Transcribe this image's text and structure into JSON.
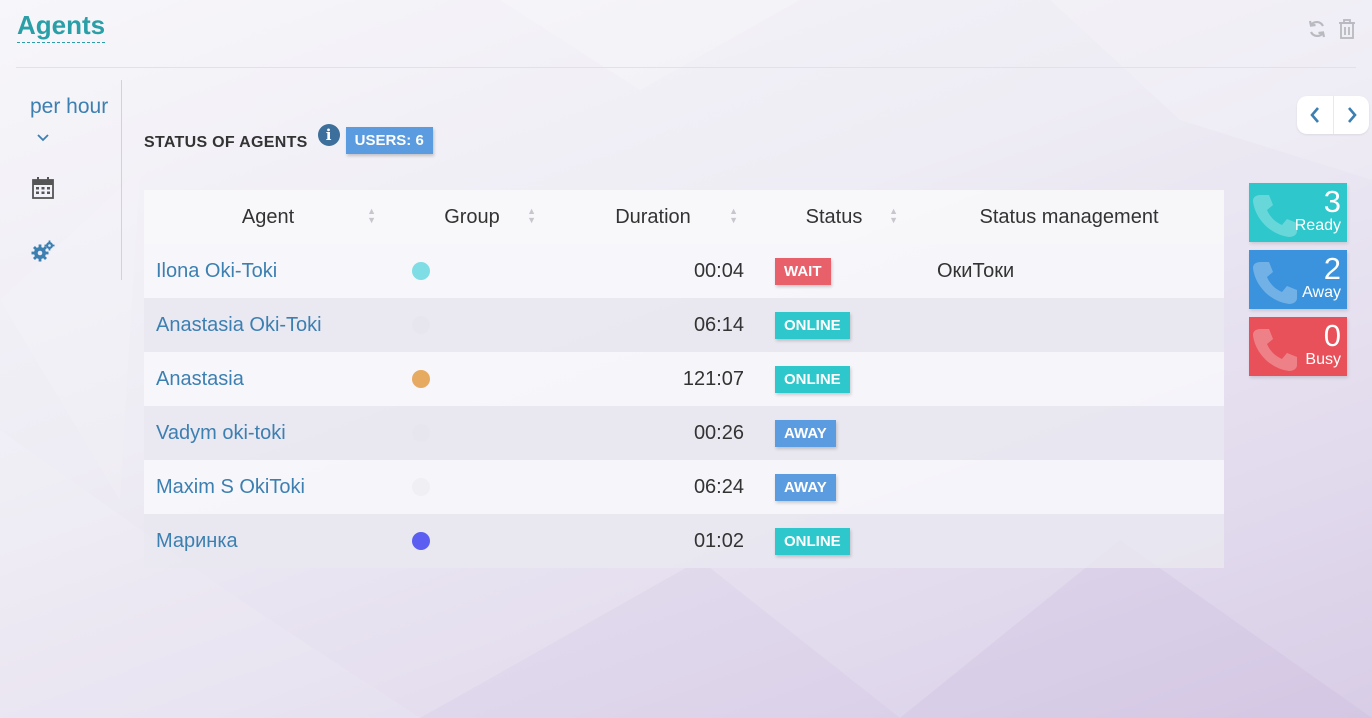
{
  "page": {
    "title": "Agents"
  },
  "sidebar": {
    "period": "per hour"
  },
  "section": {
    "title": "STATUS OF AGENTS",
    "users_badge": "USERS: 6"
  },
  "table": {
    "headers": [
      "Agent",
      "Group",
      "Duration",
      "Status",
      "Status management"
    ],
    "rows": [
      {
        "agent": "Ilona Oki-Toki",
        "group_color": "#7fdde5",
        "duration": "00:04",
        "status": "WAIT",
        "status_color": "#e8606a",
        "management": "ОкиТоки"
      },
      {
        "agent": "Anastasia Oki-Toki",
        "group_color": "#e7e6ee",
        "duration": "06:14",
        "status": "ONLINE",
        "status_color": "#2ec8cc",
        "management": ""
      },
      {
        "agent": "Anastasia",
        "group_color": "#e6aa60",
        "duration": "121:07",
        "status": "ONLINE",
        "status_color": "#2ec8cc",
        "management": ""
      },
      {
        "agent": "Vadym oki-toki",
        "group_color": "#e7e6ee",
        "duration": "00:26",
        "status": "AWAY",
        "status_color": "#5b9bdf",
        "management": ""
      },
      {
        "agent": "Maxim S OkiToki",
        "group_color": "#efeff4",
        "duration": "06:24",
        "status": "AWAY",
        "status_color": "#5b9bdf",
        "management": ""
      },
      {
        "agent": "Маринка",
        "group_color": "#5b5ef0",
        "duration": "01:02",
        "status": "ONLINE",
        "status_color": "#2ec8cc",
        "management": ""
      }
    ]
  },
  "counters": [
    {
      "value": "3",
      "label": "Ready",
      "color": "#2ec8cc"
    },
    {
      "value": "2",
      "label": "Away",
      "color": "#3a93dc"
    },
    {
      "value": "0",
      "label": "Busy",
      "color": "#e8515a"
    }
  ],
  "icons": {
    "top_tools": [
      "refresh-icon",
      "trash-icon"
    ],
    "sidebar": [
      "chevron-down-icon",
      "calendar-icon",
      "gears-icon"
    ],
    "nav": [
      "chevron-left-icon",
      "chevron-right-icon"
    ],
    "counter": "phone-icon"
  }
}
